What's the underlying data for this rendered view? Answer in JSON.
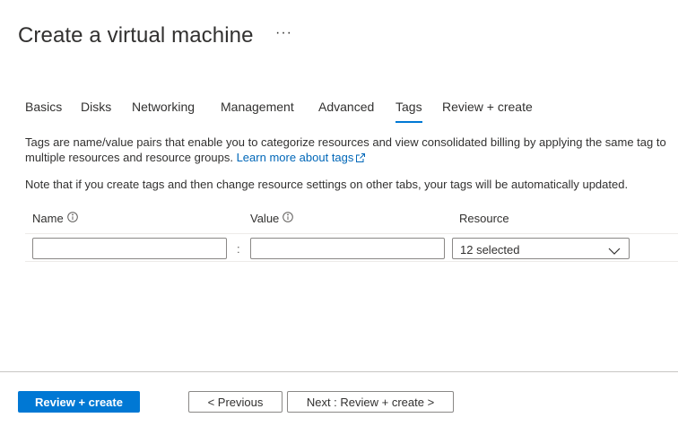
{
  "page": {
    "title": "Create a virtual machine",
    "more_label": "···"
  },
  "tabs": [
    {
      "label": "Basics"
    },
    {
      "label": "Disks"
    },
    {
      "label": "Networking"
    },
    {
      "label": "Management"
    },
    {
      "label": "Advanced"
    },
    {
      "label": "Tags"
    },
    {
      "label": "Review + create"
    }
  ],
  "active_tab": "Tags",
  "description": {
    "text": "Tags are name/value pairs that enable you to categorize resources and view consolidated billing by applying the same tag to multiple resources and resource groups.",
    "link_text": "Learn more about tags"
  },
  "note": "Note that if you create tags and then change resource settings on other tabs, your tags will be automatically updated.",
  "grid": {
    "headers": {
      "name": "Name",
      "value": "Value",
      "resource": "Resource"
    },
    "row": {
      "name_value": "",
      "value_value": "",
      "separator": ":",
      "resource_selected": "12 selected"
    }
  },
  "footer": {
    "review_create": "Review + create",
    "previous": "< Previous",
    "next": "Next : Review + create >"
  },
  "colors": {
    "accent": "#0078d4",
    "link": "#0067b8",
    "text": "#323130"
  },
  "icons": {
    "info": "info-icon",
    "external": "external-link-icon",
    "dropdown": "chevron-down-icon"
  }
}
